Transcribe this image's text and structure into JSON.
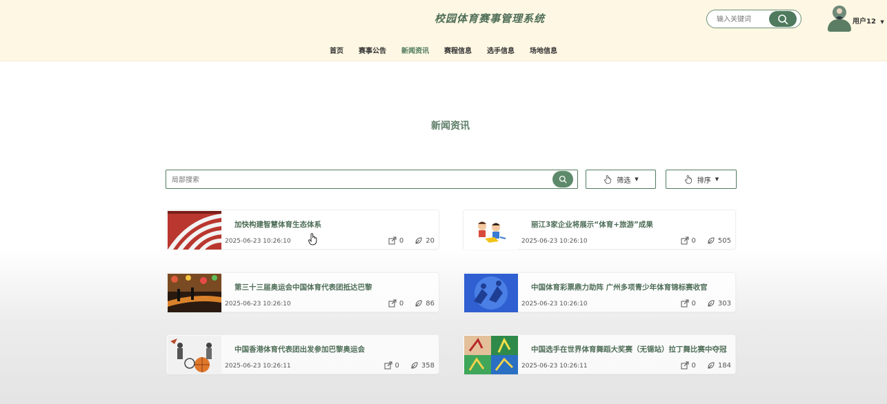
{
  "header": {
    "title": "校园体育赛事管理系统",
    "search_placeholder": "输入关键词",
    "user_name": "用户12"
  },
  "nav": [
    {
      "label": "首页",
      "active": false
    },
    {
      "label": "赛事公告",
      "active": false
    },
    {
      "label": "新闻资讯",
      "active": true
    },
    {
      "label": "赛程信息",
      "active": false
    },
    {
      "label": "选手信息",
      "active": false
    },
    {
      "label": "场地信息",
      "active": false
    }
  ],
  "page": {
    "title": "新闻资讯",
    "search_placeholder": "局部搜索",
    "filter_label": "筛选",
    "sort_label": "排序"
  },
  "news": [
    {
      "title": "加快构建智慧体育生态体系",
      "date": "2025-06-23 10:26:10",
      "shares": "0",
      "views": "20"
    },
    {
      "title": "丽江3家企业将展示“体育+旅游”成果",
      "date": "2025-06-23 10:26:10",
      "shares": "0",
      "views": "505"
    },
    {
      "title": "第三十三届奥运会中国体育代表团抵达巴黎",
      "date": "2025-06-23 10:26:10",
      "shares": "0",
      "views": "86"
    },
    {
      "title": "中国体育彩票鼎力助阵 广州多项青少年体育锦标赛收官",
      "date": "2025-06-23 10:26:10",
      "shares": "0",
      "views": "303"
    },
    {
      "title": "中国香港体育代表团出发参加巴黎奥运会",
      "date": "2025-06-23 10:26:11",
      "shares": "0",
      "views": "358"
    },
    {
      "title": "中国选手在世界体育舞蹈大奖赛（无锡站）拉丁舞比赛中夺冠",
      "date": "2025-06-23 10:26:11",
      "shares": "0",
      "views": "184"
    }
  ],
  "colors": {
    "accent": "#4f7a5e",
    "header_bg": "#fdf7e3"
  }
}
